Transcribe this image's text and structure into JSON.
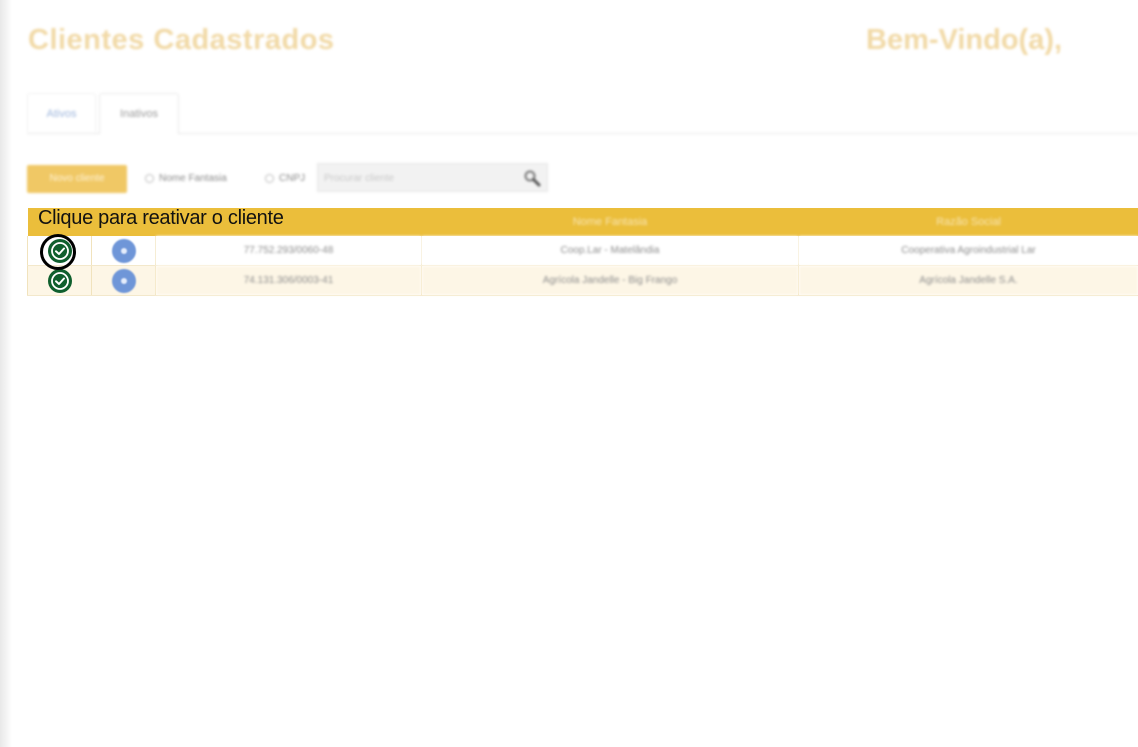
{
  "header": {
    "title": "Clientes Cadastrados",
    "welcome": "Bem-Vindo(a),"
  },
  "tabs": [
    {
      "label": "Ativos",
      "active": false
    },
    {
      "label": "Inativos",
      "active": true
    }
  ],
  "toolbar": {
    "new_client_label": "Novo cliente",
    "radio_nome_fantasia": "Nome Fantasia",
    "radio_cnpj": "CNPJ",
    "search_placeholder": "Procurar cliente"
  },
  "table": {
    "headers": [
      "",
      "",
      "",
      "Nome Fantasia",
      "Razão Social"
    ],
    "rows": [
      {
        "cnpj": "77.752.293/0060-48",
        "nome_fantasia": "Coop.Lar - Matelândia",
        "razao_social": "Cooperativa Agroindustrial Lar"
      },
      {
        "cnpj": "74.131.306/0003-41",
        "nome_fantasia": "Agrícola Jandelle - Big Frango",
        "razao_social": "Agrícola Jandelle S.A."
      }
    ]
  },
  "annotation": {
    "callout_text": "Clique para reativar o cliente"
  },
  "colors": {
    "accent": "#ebbe3b",
    "reactivate_green": "#0f5f2d",
    "view_blue": "#6f96d8"
  },
  "icons": {
    "reactivate": "check-circle-icon",
    "view": "view-icon",
    "search": "magnifier-icon"
  }
}
